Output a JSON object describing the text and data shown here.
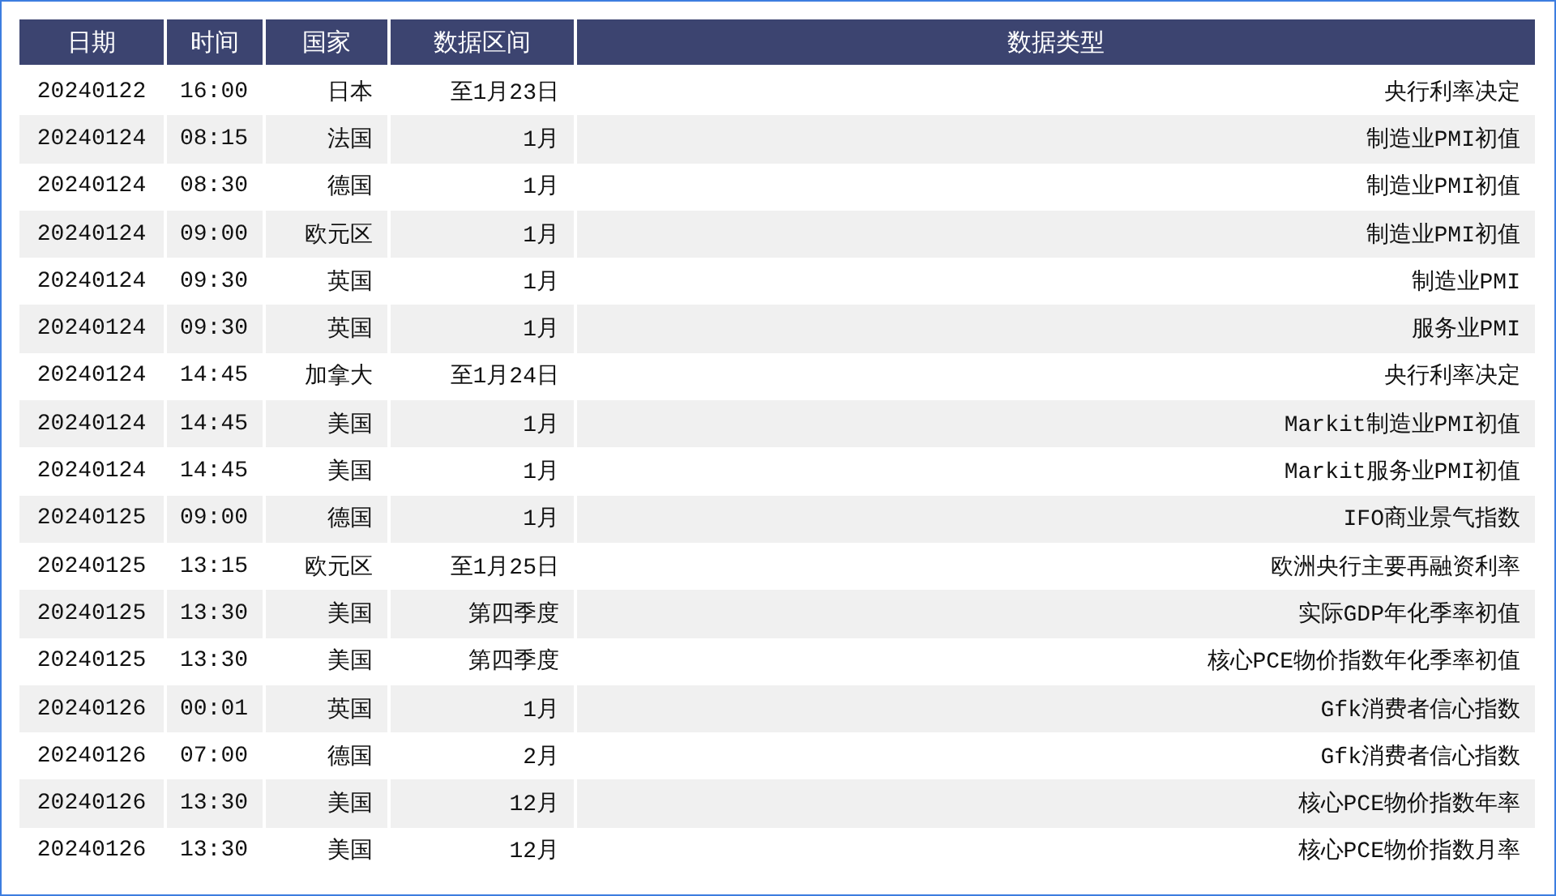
{
  "table": {
    "columns": [
      "日期",
      "时间",
      "国家",
      "数据区间",
      "数据类型"
    ],
    "rows": [
      [
        "20240122",
        "16:00",
        "日本",
        "至1月23日",
        "央行利率决定"
      ],
      [
        "20240124",
        "08:15",
        "法国",
        "1月",
        "制造业PMI初值"
      ],
      [
        "20240124",
        "08:30",
        "德国",
        "1月",
        "制造业PMI初值"
      ],
      [
        "20240124",
        "09:00",
        "欧元区",
        "1月",
        "制造业PMI初值"
      ],
      [
        "20240124",
        "09:30",
        "英国",
        "1月",
        "制造业PMI"
      ],
      [
        "20240124",
        "09:30",
        "英国",
        "1月",
        "服务业PMI"
      ],
      [
        "20240124",
        "14:45",
        "加拿大",
        "至1月24日",
        "央行利率决定"
      ],
      [
        "20240124",
        "14:45",
        "美国",
        "1月",
        "Markit制造业PMI初值"
      ],
      [
        "20240124",
        "14:45",
        "美国",
        "1月",
        "Markit服务业PMI初值"
      ],
      [
        "20240125",
        "09:00",
        "德国",
        "1月",
        "IFO商业景气指数"
      ],
      [
        "20240125",
        "13:15",
        "欧元区",
        "至1月25日",
        "欧洲央行主要再融资利率"
      ],
      [
        "20240125",
        "13:30",
        "美国",
        "第四季度",
        "实际GDP年化季率初值"
      ],
      [
        "20240125",
        "13:30",
        "美国",
        "第四季度",
        "核心PCE物价指数年化季率初值"
      ],
      [
        "20240126",
        "00:01",
        "英国",
        "1月",
        "Gfk消费者信心指数"
      ],
      [
        "20240126",
        "07:00",
        "德国",
        "2月",
        "Gfk消费者信心指数"
      ],
      [
        "20240126",
        "13:30",
        "美国",
        "12月",
        "核心PCE物价指数年率"
      ],
      [
        "20240126",
        "13:30",
        "美国",
        "12月",
        "核心PCE物价指数月率"
      ]
    ]
  }
}
